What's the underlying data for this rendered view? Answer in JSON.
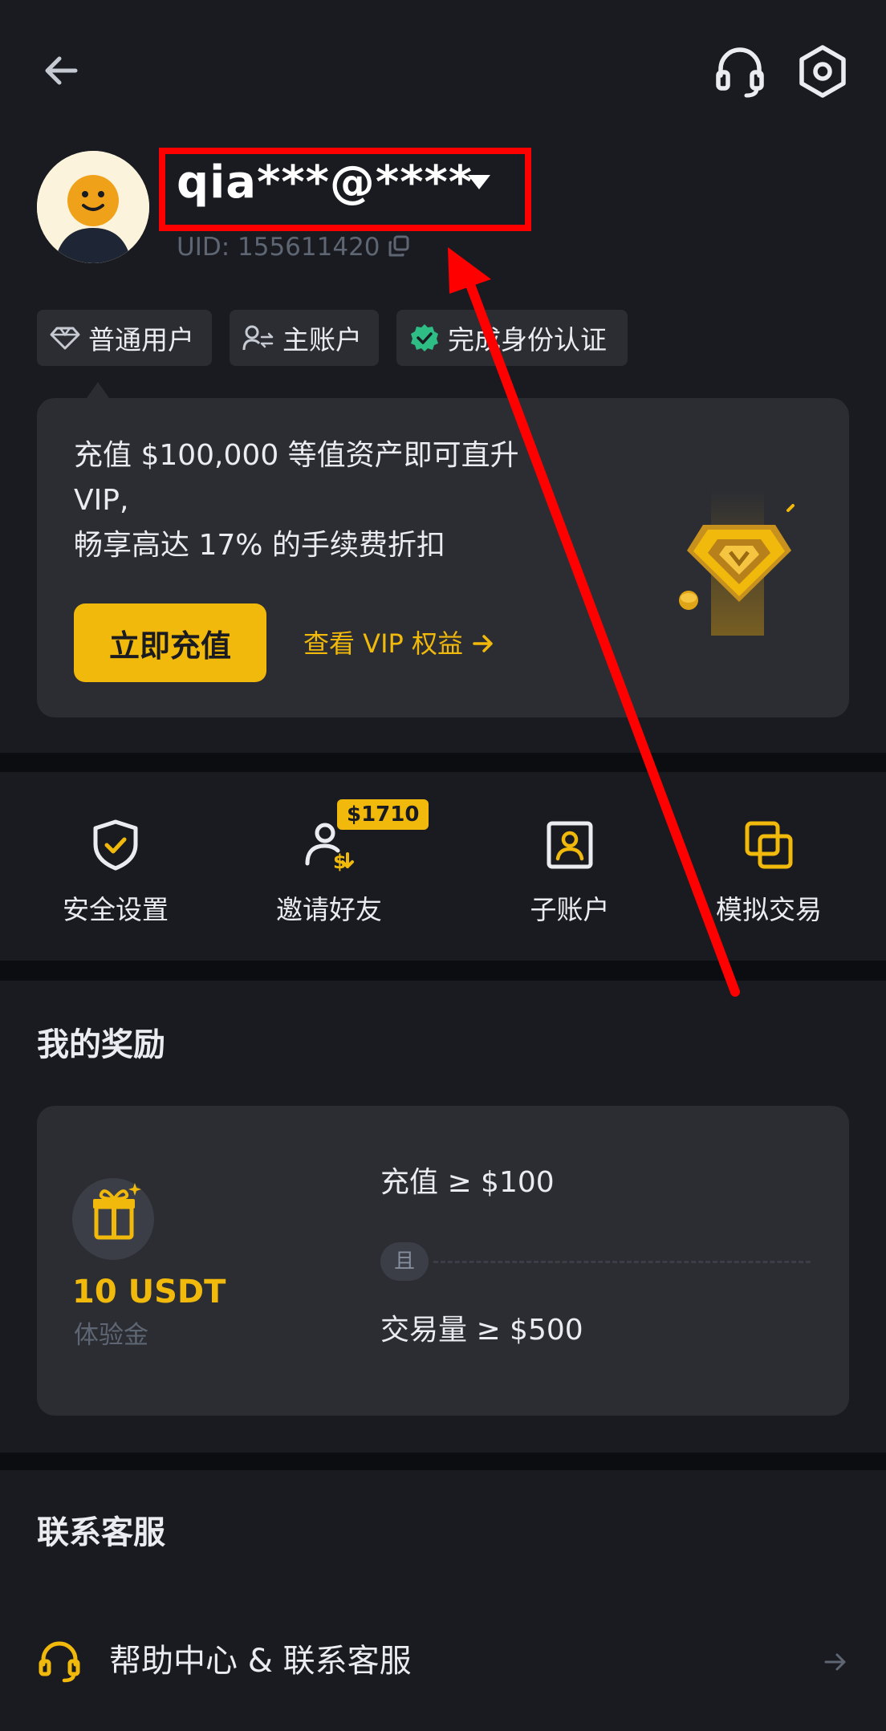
{
  "header": {
    "back_icon": "arrow-left-icon",
    "support_icon": "headset-icon",
    "settings_icon": "settings-hexagon-icon"
  },
  "profile": {
    "username": "qia***@****",
    "uid": "UID: 155611420",
    "avatar_icon": "avatar-icon"
  },
  "tags": [
    {
      "icon": "diamond-icon",
      "label": "普通用户"
    },
    {
      "icon": "account-switch-icon",
      "label": "主账户"
    },
    {
      "icon": "verified-check-icon",
      "label": "完成身份认证"
    }
  ],
  "vip_card": {
    "lines": [
      "充值 $100,000 等值资产即可直升",
      "VIP,",
      "畅享高达 17% 的手续费折扣"
    ],
    "recharge_label": "立即充值",
    "benefits_link": "查看 VIP 权益"
  },
  "shortcuts": [
    {
      "icon": "shield-check-icon",
      "label": "安全设置"
    },
    {
      "icon": "invite-friends-icon",
      "label": "邀请好友",
      "badge": "$1710"
    },
    {
      "icon": "sub-account-icon",
      "label": "子账户"
    },
    {
      "icon": "demo-trading-icon",
      "label": "模拟交易"
    }
  ],
  "rewards": {
    "title": "我的奖励",
    "amount": "10 USDT",
    "amount_sub": "体验金",
    "condition1": "充值 ≥ $100",
    "and_label": "且",
    "condition2": "交易量 ≥ $500"
  },
  "support": {
    "title": "联系客服",
    "row_label": "帮助中心 & 联系客服"
  },
  "colors": {
    "accent": "#f0b90b",
    "background": "#1a1b20",
    "card": "#2b2d33",
    "annotation": "#ff0000"
  }
}
